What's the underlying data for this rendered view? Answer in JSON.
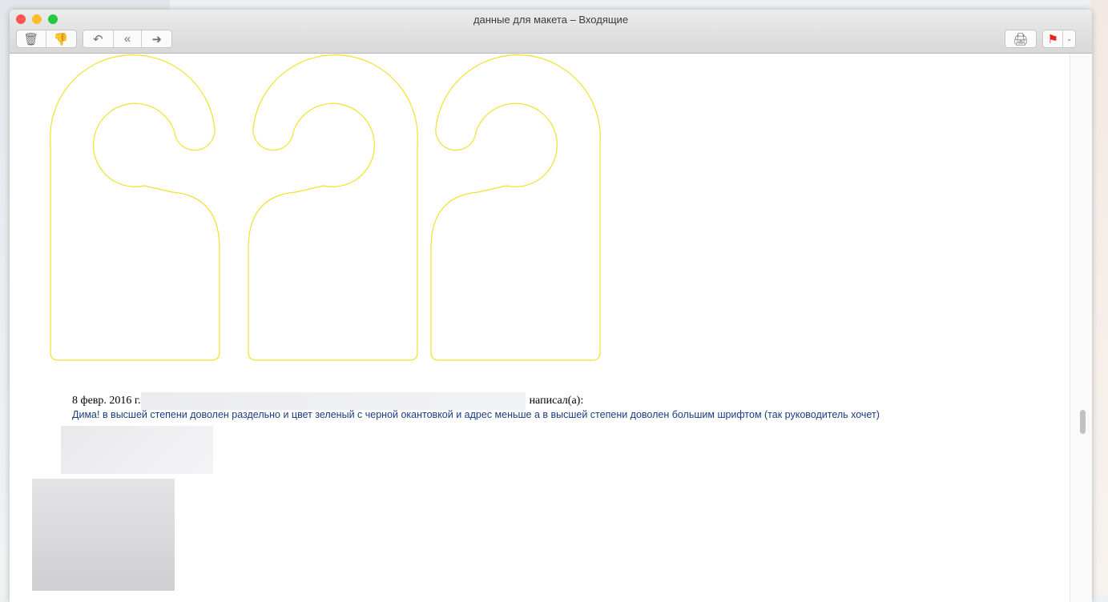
{
  "window": {
    "title": "данные для макета – Входящие"
  },
  "toolbar": {
    "delete": "delete",
    "junk": "junk",
    "reply": "reply",
    "reply_all": "reply-all",
    "forward": "forward",
    "print": "print",
    "flag": "flag"
  },
  "email": {
    "quote_date": "8 февр. 2016 г.",
    "quote_wrote": "написал(а):",
    "body": "Дима! в высшей степени доволен раздельно и цвет зеленый с черной окантовкой и адрес меньше а в высшей степени доволен большим шрифтом (так руководитель хочет)"
  },
  "colors": {
    "outline": "#f2e12a",
    "flag": "#e8231f",
    "text": "#1b3d80"
  }
}
